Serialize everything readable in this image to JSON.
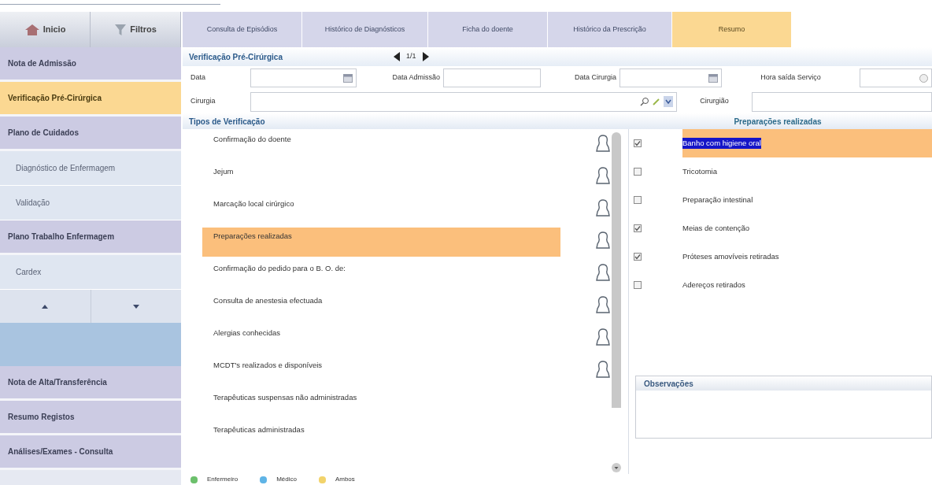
{
  "top_buttons": [
    {
      "label": "Inicio"
    },
    {
      "label": "Filtros"
    }
  ],
  "tabs": [
    {
      "label": "Consulta de Episódios",
      "selected": false
    },
    {
      "label": "Histórico de Diagnósticos",
      "selected": false
    },
    {
      "label": "Ficha do doente",
      "selected": false
    },
    {
      "label": "Histórico da Prescrição",
      "selected": false
    },
    {
      "label": "Resumo",
      "selected": true
    }
  ],
  "sidebar": {
    "items": [
      {
        "kind": "group",
        "label": "Nota de Admissão",
        "selected": false
      },
      {
        "kind": "group",
        "label": "Verificação Pré-Cirúrgica",
        "selected": true
      },
      {
        "kind": "group",
        "label": "Plano de Cuidados",
        "selected": false
      },
      {
        "kind": "sub",
        "label": "Diagnóstico de Enfermagem",
        "selected": false
      },
      {
        "kind": "sub",
        "label": "Validação",
        "selected": false
      },
      {
        "kind": "group",
        "label": "Plano Trabalho Enfermagem",
        "selected": false
      },
      {
        "kind": "sub",
        "label": "Cardex",
        "selected": false
      },
      {
        "kind": "pager"
      },
      {
        "kind": "spacer"
      },
      {
        "kind": "group",
        "label": "Nota de Alta/Transferência",
        "selected": false
      },
      {
        "kind": "group",
        "label": "Resumo Registos",
        "selected": false
      },
      {
        "kind": "group",
        "label": "Análises/Exames - Consulta",
        "selected": false
      }
    ]
  },
  "panel": {
    "title": "Verificação Pré-Cirúrgica",
    "page": "1/1",
    "fields": [
      {
        "label": "Data",
        "kind": "date"
      },
      {
        "label": "Data Admissão",
        "kind": "text"
      },
      {
        "label": "Data Cirurgia",
        "kind": "date"
      },
      {
        "label": "Hora saída Serviço",
        "kind": "time"
      }
    ],
    "surgery": {
      "label": "Cirurgia"
    },
    "surgeon": {
      "label": "Cirurgião"
    }
  },
  "verification_types": {
    "title": "Tipos de Verificação",
    "items": [
      {
        "label": "Confirmação do doente",
        "selected": false,
        "person_icon": true
      },
      {
        "label": "Jejum",
        "selected": false,
        "person_icon": true
      },
      {
        "label": "Marcação local cirúrgico",
        "selected": false,
        "person_icon": true
      },
      {
        "label": "Preparações realizadas",
        "selected": true,
        "person_icon": true
      },
      {
        "label": "Confirmação do pedido para o B. O. de:",
        "selected": false,
        "person_icon": true
      },
      {
        "label": "Consulta de anestesia efectuada",
        "selected": false,
        "person_icon": true
      },
      {
        "label": "Alergias conhecidas",
        "selected": false,
        "person_icon": true
      },
      {
        "label": "MCDT's realizados e disponíveis",
        "selected": false,
        "person_icon": true
      },
      {
        "label": "Terapêuticas suspensas não administradas",
        "selected": false,
        "person_icon": false
      },
      {
        "label": "Terapêuticas administradas",
        "selected": false,
        "person_icon": false
      }
    ]
  },
  "preparations": {
    "title": "Preparações realizadas",
    "items": [
      {
        "label": "Banho com higiene oral",
        "checked": true,
        "selected": true
      },
      {
        "label": "Tricotomia",
        "checked": false,
        "selected": false
      },
      {
        "label": "Preparação intestinal",
        "checked": false,
        "selected": false
      },
      {
        "label": "Meias de contenção",
        "checked": true,
        "selected": false
      },
      {
        "label": "Próteses amovíveis retiradas",
        "checked": true,
        "selected": false
      },
      {
        "label": "Adereços retirados",
        "checked": false,
        "selected": false
      }
    ]
  },
  "observations": {
    "title": "Observações"
  },
  "legend": [
    {
      "label": "Enfermeiro",
      "color": "#6cc06c"
    },
    {
      "label": "Médico",
      "color": "#5fb4e6"
    },
    {
      "label": "Ambos",
      "color": "#f2d36b"
    }
  ]
}
